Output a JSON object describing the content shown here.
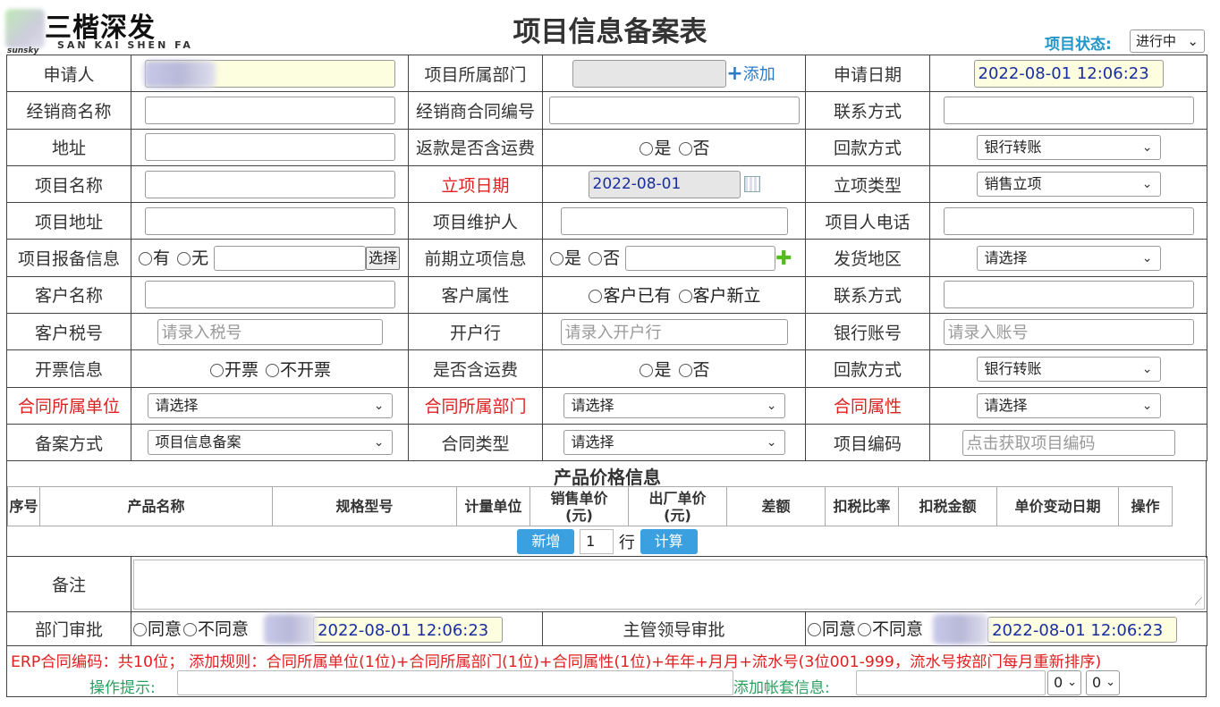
{
  "header": {
    "logo_text": "三楷深发",
    "logo_sub": "SAN KAI SHEN FA",
    "logo_tiny": "sunsky",
    "title": "项目信息备案表",
    "status_label": "项目状态:",
    "status_value": "进行中"
  },
  "form": {
    "applicant_label": "申请人",
    "dept_label": "项目所属部门",
    "add_label": "添加",
    "apply_date_label": "申请日期",
    "apply_date_value": "2022-08-01 12:06:23",
    "dealer_name_label": "经销商名称",
    "dealer_contract_label": "经销商合同编号",
    "contact_label": "联系方式",
    "address_label": "地址",
    "rebate_freight_label": "返款是否含运费",
    "yes": "是",
    "no": "否",
    "payment_label": "回款方式",
    "payment_value": "银行转账",
    "project_name_label": "项目名称",
    "setup_date_label": "立项日期",
    "setup_date_value": "2022-08-01",
    "setup_type_label": "立项类型",
    "setup_type_value": "销售立项",
    "project_address_label": "项目地址",
    "maintainer_label": "项目维护人",
    "project_phone_label": "项目人电话",
    "report_info_label": "项目报备信息",
    "have": "有",
    "none": "无",
    "choose_btn": "选择",
    "prior_setup_label": "前期立项信息",
    "ship_region_label": "发货地区",
    "please_select": "请选择",
    "customer_name_label": "客户名称",
    "customer_attr_label": "客户属性",
    "customer_exist": "客户已有",
    "customer_new": "客户新立",
    "contact2_label": "联系方式",
    "tax_no_label": "客户税号",
    "tax_no_placeholder": "请录入税号",
    "bank_label": "开户行",
    "bank_placeholder": "请录入开户行",
    "account_label": "银行账号",
    "account_placeholder": "请录入账号",
    "invoice_label": "开票信息",
    "invoice_yes": "开票",
    "invoice_no": "不开票",
    "freight_label": "是否含运费",
    "payment2_label": "回款方式",
    "payment2_value": "银行转账",
    "contract_unit_label": "合同所属单位",
    "contract_unit_value": "请选择",
    "contract_dept_label": "合同所属部门",
    "contract_dept_value": "请选择",
    "contract_attr_label": "合同属性",
    "contract_attr_value": "请选择",
    "record_method_label": "备案方式",
    "record_method_value": "项目信息备案",
    "contract_type_label": "合同类型",
    "contract_type_value": "请选择",
    "project_code_label": "项目编码",
    "project_code_placeholder": "点击获取项目编码"
  },
  "products": {
    "section_title": "产品价格信息",
    "columns": [
      "序号",
      "产品名称",
      "规格型号",
      "计量单位",
      "销售单价\n(元)",
      "出厂单价\n(元)",
      "差额",
      "扣税比率",
      "扣税金额",
      "单价变动日期",
      "操作"
    ],
    "add_btn": "新增",
    "row_count": "1",
    "row_unit": "行",
    "calc_btn": "计算"
  },
  "bottom": {
    "remark_label": "备注",
    "dept_approve_label": "部门审批",
    "agree": "同意",
    "disagree": "不同意",
    "dept_approve_date": "2022-08-01 12:06:23",
    "leader_approve_label": "主管领导审批",
    "leader_approve_date": "2022-08-01 12:06:23"
  },
  "footer": {
    "rule_text": "ERP合同编码：共10位；  添加规则：合同所属单位(1位)+合同所属部门(1位)+合同属性(1位)+年年+月月+流水号(3位001-999，流水号按部门每月重新排序)",
    "op_hint_label": "操作提示:",
    "account_set_label": "添加帐套信息:",
    "select1": "0",
    "select2": "0"
  },
  "colors": {
    "status_blue": "#2196c8",
    "required_red": "#e02020",
    "hint_green": "#2aa060",
    "button_blue": "#3aa0e0"
  }
}
